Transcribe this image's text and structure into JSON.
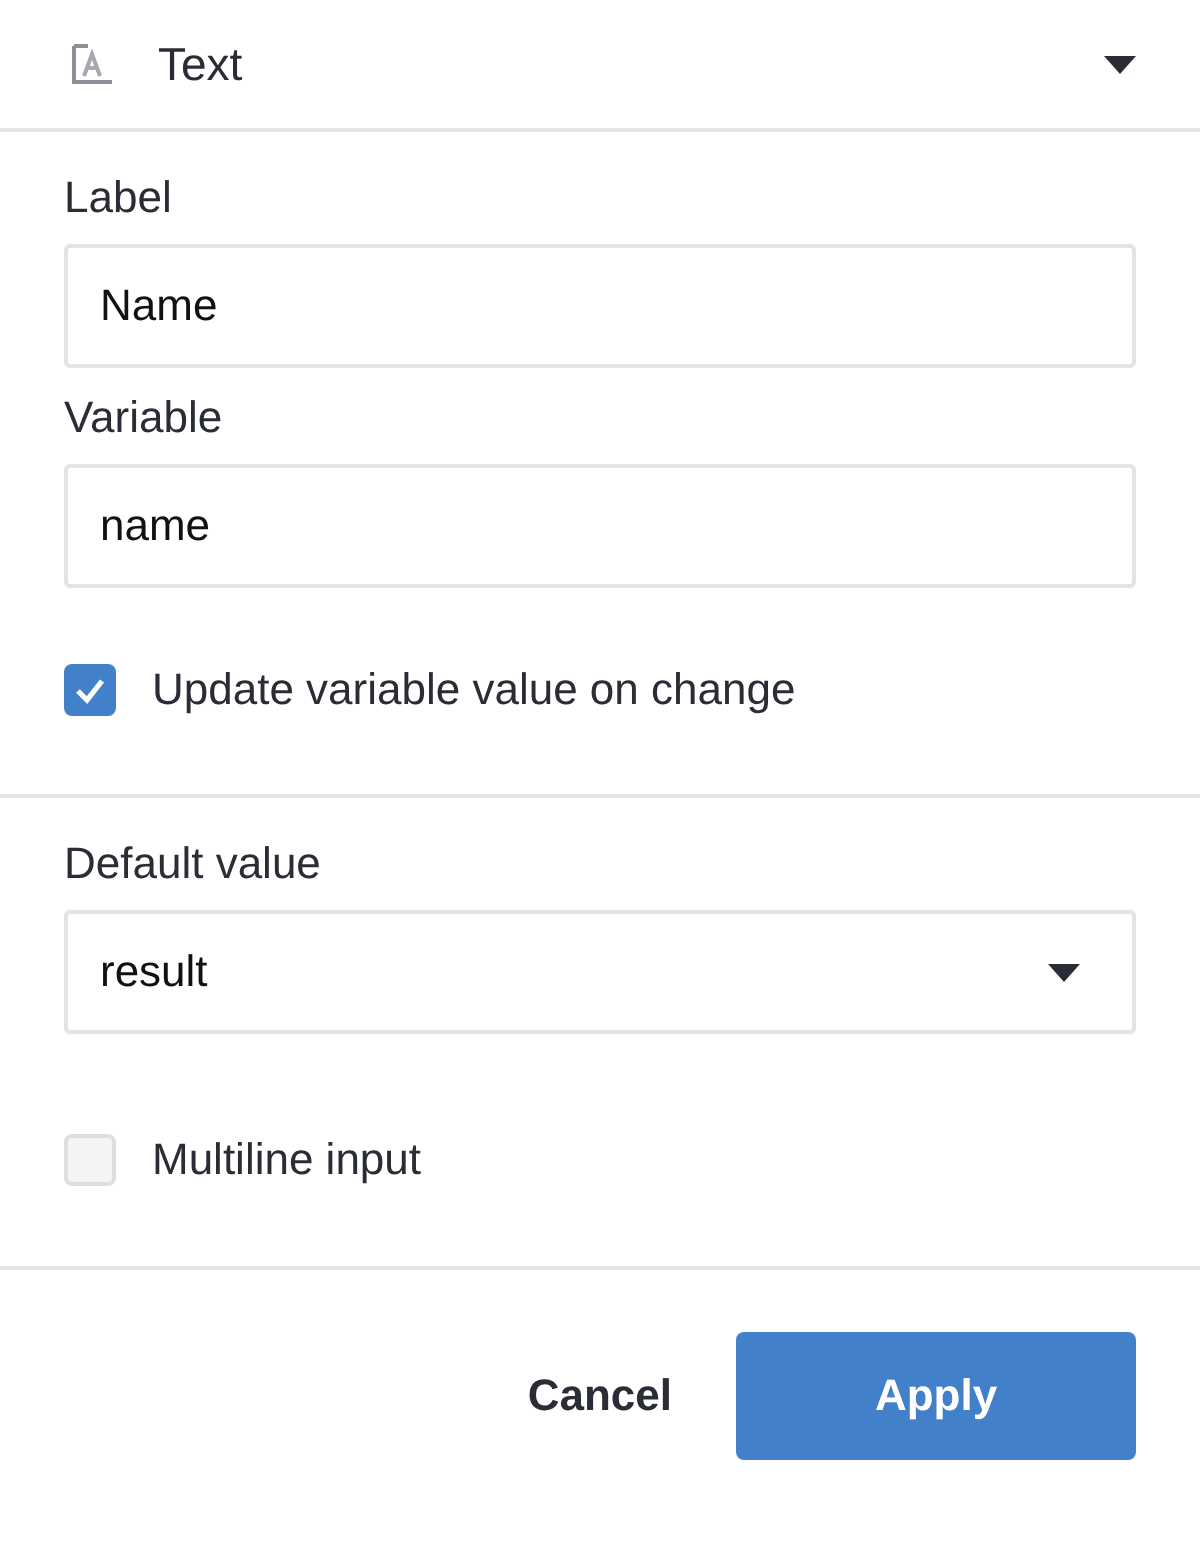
{
  "header": {
    "title": "Text"
  },
  "fields": [
    {
      "label": "Label",
      "value": "Name"
    },
    {
      "label": "Variable",
      "value": "name"
    }
  ],
  "update_checkbox": {
    "label": "Update variable value on change",
    "checked": true
  },
  "default_value": {
    "label": "Default value",
    "value": "result"
  },
  "multiline_checkbox": {
    "label": "Multiline input",
    "checked": false
  },
  "buttons": [
    {
      "label": "Cancel",
      "kind": "secondary"
    },
    {
      "label": "Apply",
      "kind": "primary"
    }
  ]
}
